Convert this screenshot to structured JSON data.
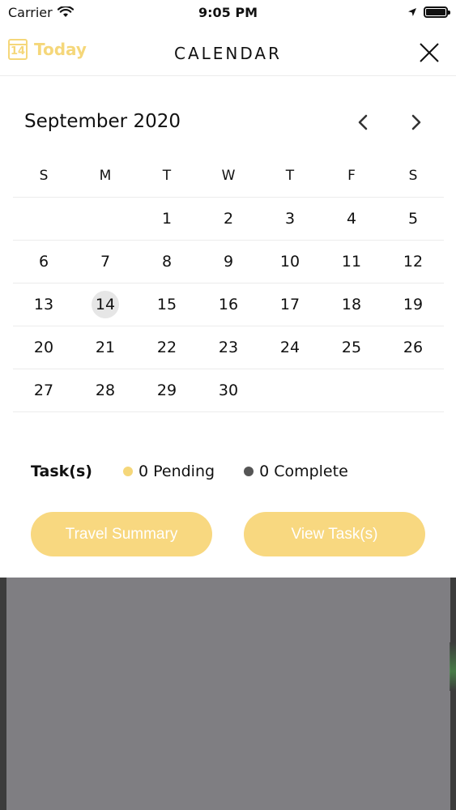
{
  "status_bar": {
    "carrier": "Carrier",
    "time": "9:05 PM"
  },
  "nav": {
    "today_label": "Today",
    "today_icon_day": "14",
    "title": "CALENDAR"
  },
  "calendar": {
    "month_title": "September 2020",
    "weekdays": [
      "S",
      "M",
      "T",
      "W",
      "T",
      "F",
      "S"
    ],
    "weeks": [
      [
        "",
        "",
        "1",
        "2",
        "3",
        "4",
        "5"
      ],
      [
        "6",
        "7",
        "8",
        "9",
        "10",
        "11",
        "12"
      ],
      [
        "13",
        "14",
        "15",
        "16",
        "17",
        "18",
        "19"
      ],
      [
        "20",
        "21",
        "22",
        "23",
        "24",
        "25",
        "26"
      ],
      [
        "27",
        "28",
        "29",
        "30",
        "",
        "",
        ""
      ]
    ],
    "selected_day": "14"
  },
  "tasks": {
    "label": "Task(s)",
    "pending": "0 Pending",
    "complete": "0 Complete",
    "pending_color": "#f5d77a",
    "complete_color": "#555555"
  },
  "actions": {
    "travel_summary": "Travel Summary",
    "view_tasks": "View Task(s)",
    "button_color": "#f8d880"
  },
  "colors": {
    "accent": "#f5d77a",
    "divider": "#ececec",
    "backdrop": "#7f7e82"
  }
}
